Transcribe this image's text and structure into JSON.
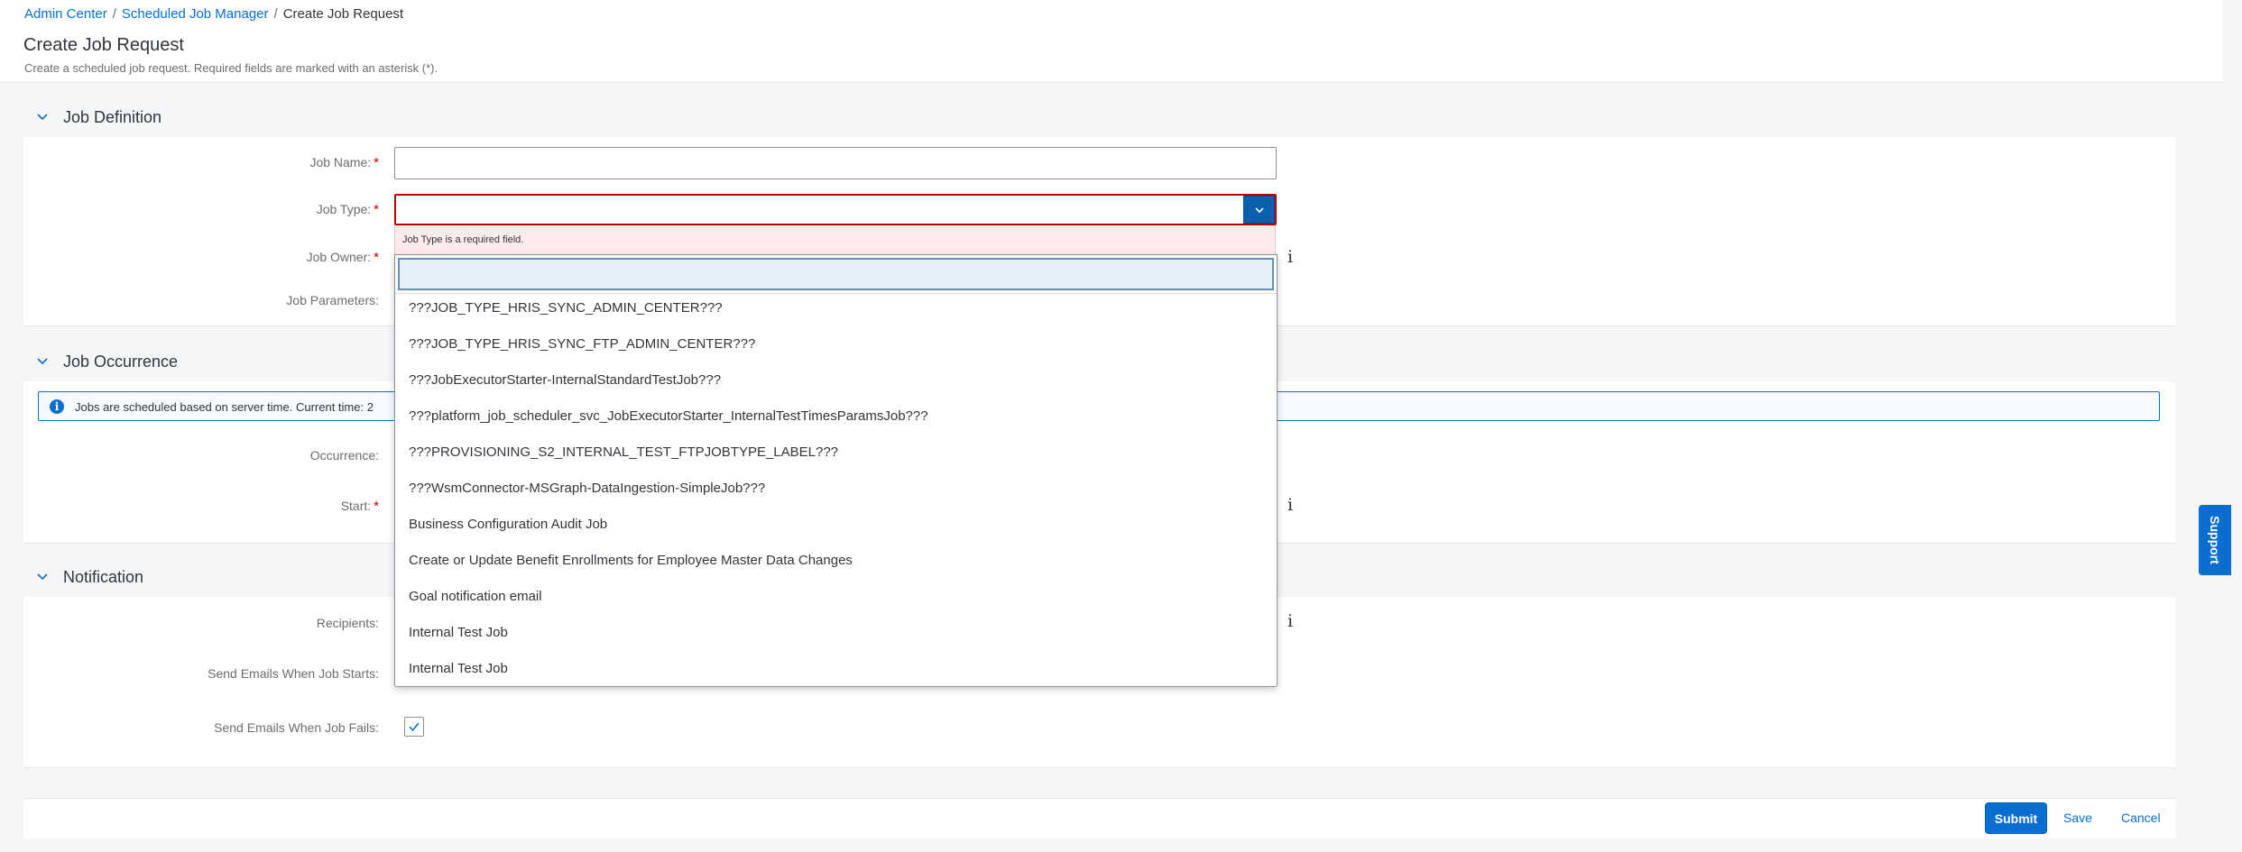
{
  "breadcrumb": {
    "items": [
      "Admin Center",
      "Scheduled Job Manager",
      "Create Job Request"
    ],
    "separator": "/"
  },
  "header": {
    "title": "Create Job Request",
    "subtitle": "Create a scheduled job request. Required fields are marked with an asterisk (*)."
  },
  "sections": {
    "job_definition": {
      "title": "Job Definition",
      "fields": {
        "job_name": {
          "label": "Job Name:",
          "required": "*",
          "value": ""
        },
        "job_type": {
          "label": "Job Type:",
          "required": "*",
          "value": "",
          "error": "Job Type is a required field."
        },
        "job_owner": {
          "label": "Job Owner:",
          "required": "*"
        },
        "job_parameters": {
          "label": "Job Parameters:"
        }
      }
    },
    "job_occurrence": {
      "title": "Job Occurrence",
      "info": "Jobs are scheduled based on server time. Current time: 2",
      "fields": {
        "occurrence": {
          "label": "Occurrence:"
        },
        "start": {
          "label": "Start:",
          "required": "*"
        }
      }
    },
    "notification": {
      "title": "Notification",
      "fields": {
        "recipients": {
          "label": "Recipients:"
        },
        "send_start": {
          "label": "Send Emails When Job Starts:"
        },
        "send_fail": {
          "label": "Send Emails When Job Fails:",
          "checked": true
        }
      }
    }
  },
  "dropdown": {
    "search_value": "",
    "options": [
      "???JOB_TYPE_HRIS_SYNC_ADMIN_CENTER???",
      "???JOB_TYPE_HRIS_SYNC_FTP_ADMIN_CENTER???",
      "???JobExecutorStarter-InternalStandardTestJob???",
      "???platform_job_scheduler_svc_JobExecutorStarter_InternalTestTimesParamsJob???",
      "???PROVISIONING_S2_INTERNAL_TEST_FTPJOBTYPE_LABEL???",
      "???WsmConnector-MSGraph-DataIngestion-SimpleJob???",
      "Business Configuration Audit Job",
      "Create or Update Benefit Enrollments for Employee Master Data Changes",
      "Goal notification email",
      "Internal Test Job",
      "Internal Test Job"
    ]
  },
  "info_icon_glyph": "i",
  "footer": {
    "submit": "Submit",
    "save": "Save",
    "cancel": "Cancel"
  },
  "support": "Support",
  "colors": {
    "accent": "#0a6ed1",
    "error": "#bb0000",
    "error_bg": "#ffebeb"
  }
}
